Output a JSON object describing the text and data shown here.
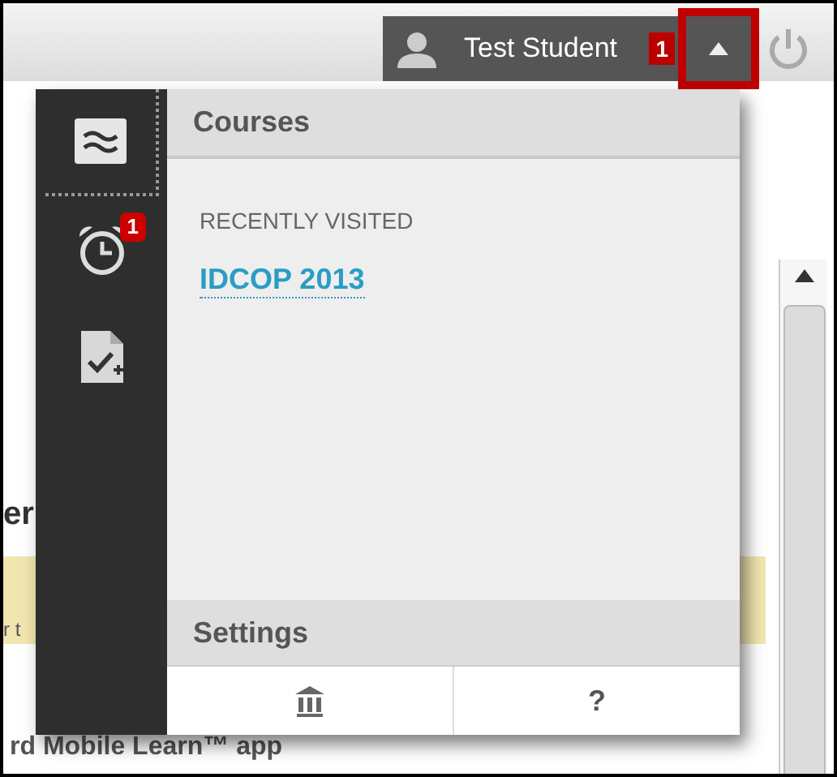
{
  "header": {
    "user_name": "Test Student",
    "notification_count": "1",
    "menu_expanded": true
  },
  "sidebar": {
    "items": [
      {
        "kind": "courses",
        "selected": true
      },
      {
        "kind": "alerts",
        "selected": false,
        "badge": "1"
      },
      {
        "kind": "grades",
        "selected": false
      }
    ]
  },
  "panel": {
    "title": "Courses",
    "section_label": "RECENTLY VISITED",
    "courses": [
      "IDCOP 2013"
    ],
    "footer_title": "Settings",
    "footer_buttons": [
      {
        "kind": "home"
      },
      {
        "kind": "help",
        "label": "?"
      }
    ]
  },
  "background_texts": [
    "er",
    "r t",
    "rd Mobile Learn™ app"
  ]
}
